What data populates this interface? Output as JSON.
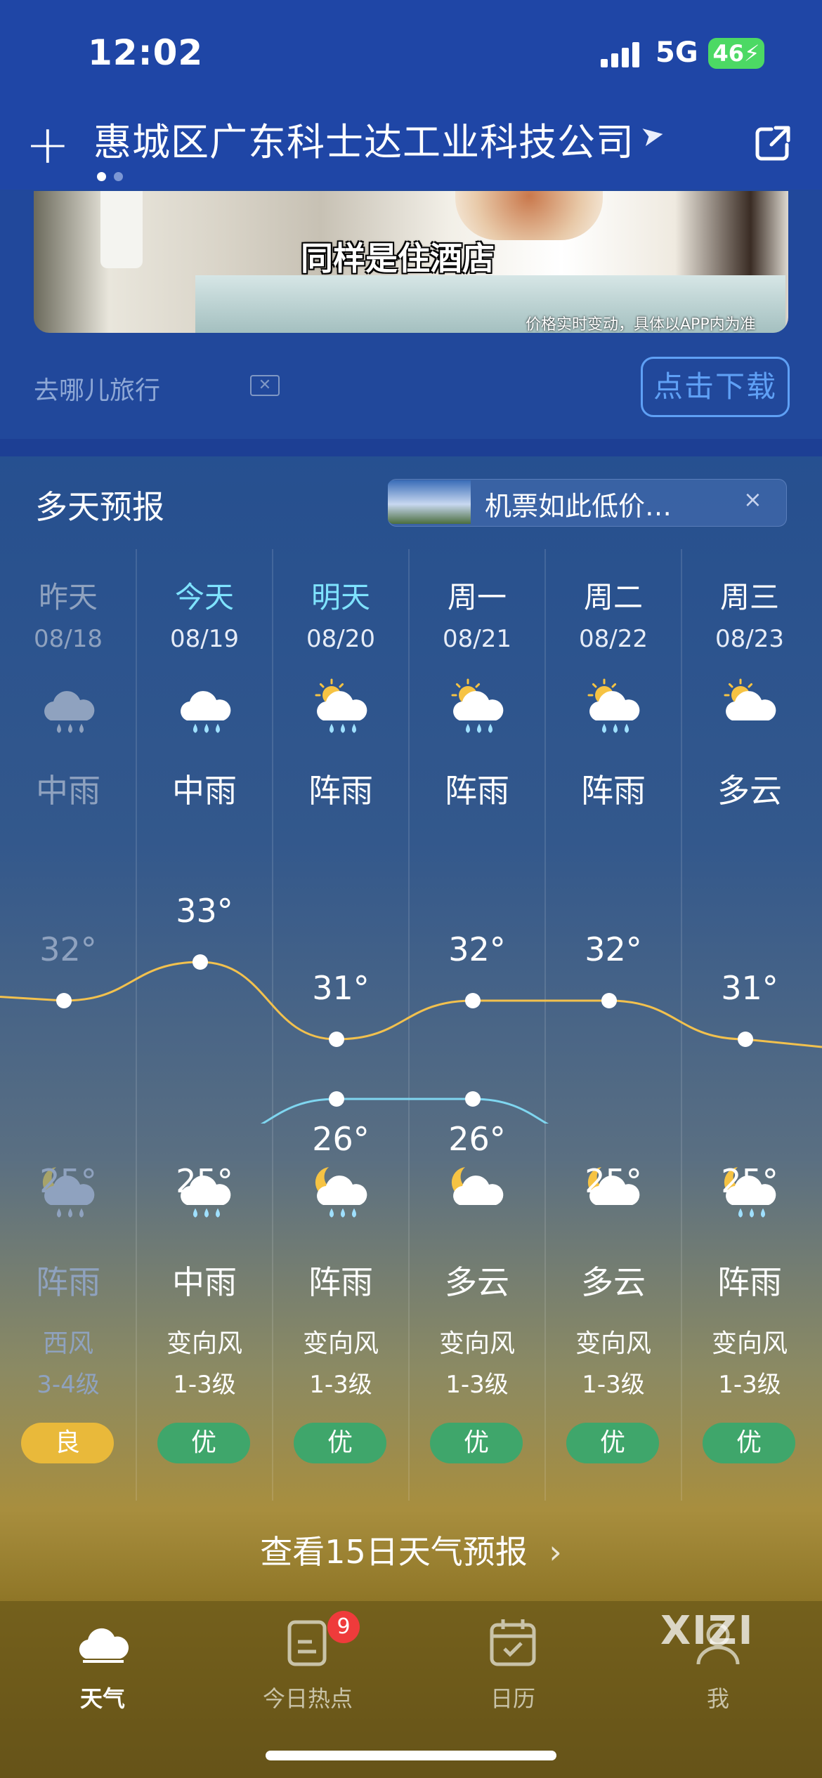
{
  "status_bar": {
    "time": "12:02",
    "network": "5G",
    "battery": "46"
  },
  "header": {
    "location": "惠城区广东科士达工业科技公司"
  },
  "ad": {
    "caption": "同样是住酒店",
    "note": "价格实时变动，具体以APP内为准",
    "source": "去哪儿旅行",
    "close_label": "✕",
    "download_label": "点击下载"
  },
  "forecast": {
    "title": "多天预报",
    "promo_text": "机票如此低价…",
    "promo_close": "×",
    "days": [
      {
        "day": "昨天",
        "date": "08/18",
        "day_cond": "中雨",
        "high": "32°",
        "low": "25°",
        "night_cond": "阵雨",
        "wind": "西风",
        "level": "3-4级",
        "aqi": "良",
        "past": true
      },
      {
        "day": "今天",
        "date": "08/19",
        "day_cond": "中雨",
        "high": "33°",
        "low": "25°",
        "night_cond": "中雨",
        "wind": "变向风",
        "level": "1-3级",
        "aqi": "优",
        "past": false
      },
      {
        "day": "明天",
        "date": "08/20",
        "day_cond": "阵雨",
        "high": "31°",
        "low": "26°",
        "night_cond": "阵雨",
        "wind": "变向风",
        "level": "1-3级",
        "aqi": "优",
        "past": false
      },
      {
        "day": "周一",
        "date": "08/21",
        "day_cond": "阵雨",
        "high": "32°",
        "low": "26°",
        "night_cond": "多云",
        "wind": "变向风",
        "level": "1-3级",
        "aqi": "优",
        "past": false
      },
      {
        "day": "周二",
        "date": "08/22",
        "day_cond": "阵雨",
        "high": "32°",
        "low": "25°",
        "night_cond": "多云",
        "wind": "变向风",
        "level": "1-3级",
        "aqi": "优",
        "past": false
      },
      {
        "day": "周三",
        "date": "08/23",
        "day_cond": "多云",
        "high": "31°",
        "low": "25°",
        "night_cond": "阵雨",
        "wind": "变向风",
        "level": "1-3级",
        "aqi": "优",
        "past": false
      }
    ],
    "more_label": "查看15日天气预报"
  },
  "colors": {
    "high_line": "#f2c14e",
    "low_line": "#7fd6f0",
    "aqi_good": "#e9b93a",
    "aqi_excellent": "#3fa66b",
    "accent_today": "#7fe3ff"
  },
  "tabs": [
    {
      "label": "天气",
      "icon": "cloud-icon",
      "active": true
    },
    {
      "label": "今日热点",
      "icon": "news-icon",
      "badge": "9",
      "active": false
    },
    {
      "label": "日历",
      "icon": "calendar-icon",
      "active": false
    },
    {
      "label": "我",
      "icon": "profile-icon",
      "active": false
    }
  ],
  "watermark": "XIZI"
}
